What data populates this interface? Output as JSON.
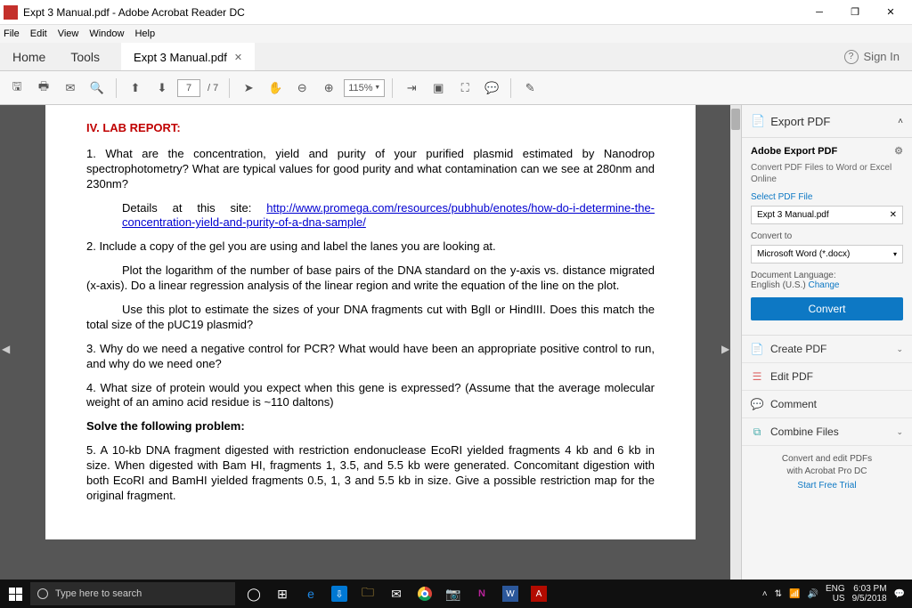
{
  "window": {
    "title": "Expt 3 Manual.pdf - Adobe Acrobat Reader DC"
  },
  "menu": {
    "file": "File",
    "edit": "Edit",
    "view": "View",
    "window": "Window",
    "help": "Help"
  },
  "tabs": {
    "home": "Home",
    "tools": "Tools",
    "file": "Expt 3 Manual.pdf"
  },
  "signin": "Sign In",
  "toolbar": {
    "page": "7",
    "page_total": "/ 7",
    "zoom": "115%"
  },
  "doc": {
    "heading": "IV. LAB REPORT:",
    "q1a": "1. What are the concentration, yield and purity of your purified plasmid estimated by Nanodrop spectrophotometry? What are typical values for good purity and what contamination can we see at 280nm and 230nm?",
    "q1b_pre": "Details at this site: ",
    "q1b_link": "http://www.promega.com/resources/pubhub/enotes/how-do-i-determine-the-concentration-yield-and-purity-of-a-dna-sample/",
    "q2a": "2. Include a copy of the gel you are using and label the lanes you are looking at.",
    "q2b": "Plot the logarithm of the number of base pairs of the DNA standard on the y-axis vs. distance migrated (x-axis). Do a linear regression analysis of the linear region and write the equation of the line on the plot.",
    "q2c": "Use this plot to estimate the sizes of your DNA fragments cut with BglI or HindIII. Does this match the total size of the pUC19 plasmid?",
    "q3": "3. Why do we need a negative control for PCR? What would have been an appropriate positive control to run, and why do we need one?",
    "q4": "4. What size of protein would you expect when this gene is expressed?  (Assume that the average molecular weight of an amino acid residue is ~110 daltons)",
    "solve": "Solve the following problem:",
    "q5": "5. A 10-kb DNA fragment digested with restriction endonuclease EcoRI yielded fragments 4 kb and 6 kb in size.  When digested with Bam HI, fragments 1, 3.5, and 5.5 kb were generated.  Concomitant digestion with both EcoRI and BamHI yielded fragments 0.5, 1, 3 and 5.5 kb in size.  Give a possible restriction map for the original fragment."
  },
  "side": {
    "export_pdf": "Export PDF",
    "adobe_export": "Adobe Export PDF",
    "convert_desc": "Convert PDF Files to Word or Excel Online",
    "select_file": "Select PDF File",
    "file_name": "Expt 3 Manual.pdf",
    "convert_to": "Convert to",
    "convert_target": "Microsoft Word (*.docx)",
    "doc_lang_label": "Document Language:",
    "doc_lang": "English (U.S.) ",
    "change": "Change",
    "convert_btn": "Convert",
    "create_pdf": "Create PDF",
    "edit_pdf": "Edit PDF",
    "comment": "Comment",
    "combine": "Combine Files",
    "footer1": "Convert and edit PDFs",
    "footer2": "with Acrobat Pro DC",
    "trial": "Start Free Trial"
  },
  "taskbar": {
    "search": "Type here to search",
    "lang": "ENG",
    "region": "US",
    "time": "6:03 PM",
    "date": "9/5/2018"
  }
}
